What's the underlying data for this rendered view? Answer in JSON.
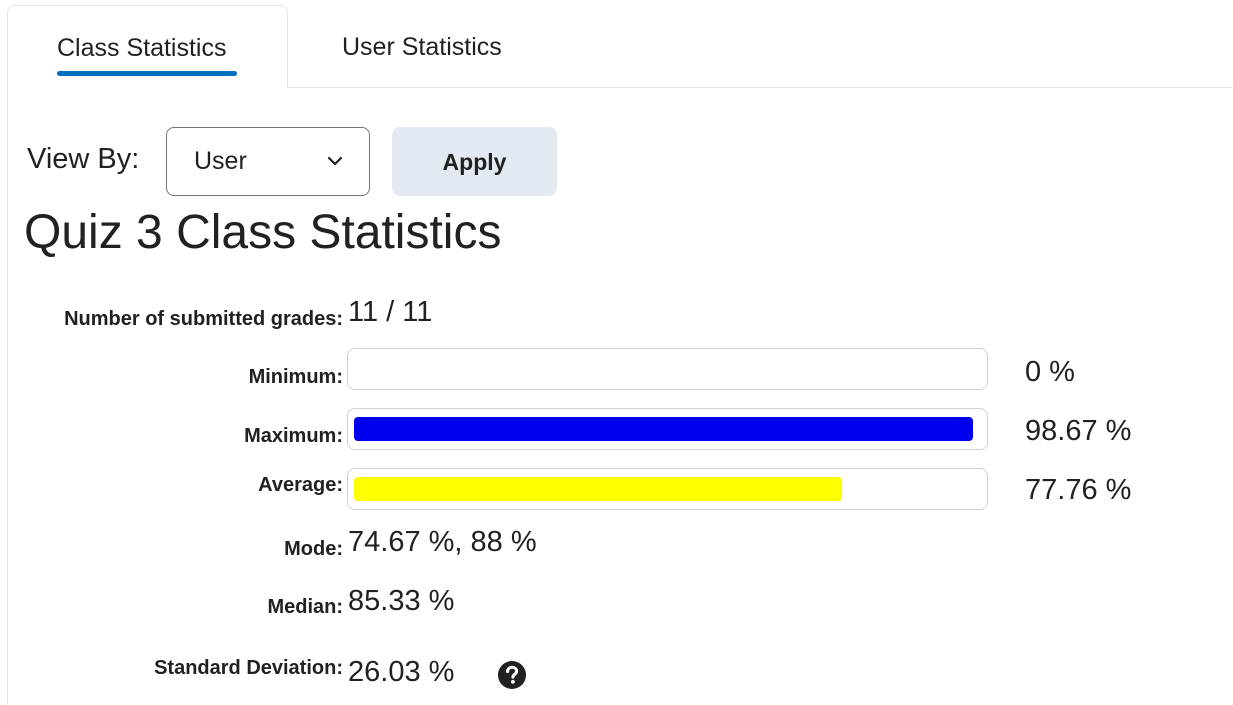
{
  "tabs": [
    {
      "label": "Class Statistics",
      "active": true
    },
    {
      "label": "User Statistics",
      "active": false
    }
  ],
  "view_by": {
    "label": "View By:",
    "selected": "User",
    "apply_label": "Apply"
  },
  "title": "Quiz 3 Class Statistics",
  "stats": {
    "submitted": {
      "label": "Number of submitted grades:",
      "value": "11 / 11"
    },
    "minimum": {
      "label": "Minimum:",
      "value": "0 %",
      "percent": 0,
      "color": "#ffffff"
    },
    "maximum": {
      "label": "Maximum:",
      "value": "98.67 %",
      "percent": 98.67,
      "color": "#0000ee"
    },
    "average": {
      "label": "Average:",
      "value": "77.76 %",
      "percent": 77.76,
      "color": "#ffff00"
    },
    "mode": {
      "label": "Mode:",
      "value": "74.67 %, 88 %"
    },
    "median": {
      "label": "Median:",
      "value": "85.33 %"
    },
    "std_dev": {
      "label": "Standard Deviation:",
      "value": "26.03 %"
    }
  },
  "icons": {
    "help": "question-circle-icon",
    "chevron": "chevron-down-icon"
  },
  "colors": {
    "tab_underline": "#006fbf",
    "apply_bg": "#e3e9f1"
  }
}
